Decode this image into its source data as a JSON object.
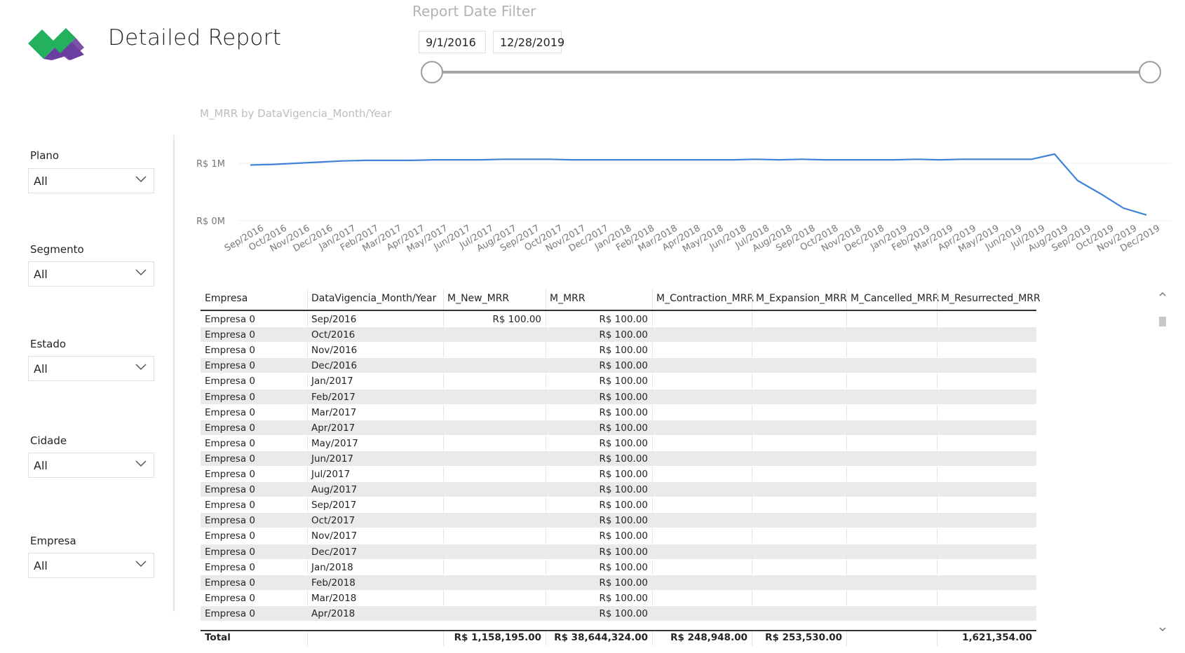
{
  "header": {
    "title": "Detailed Report"
  },
  "date_filter": {
    "title": "Report Date Filter",
    "start": "9/1/2016",
    "end": "12/28/2019"
  },
  "slicers": [
    {
      "label": "Plano",
      "value": "All"
    },
    {
      "label": "Segmento",
      "value": "All"
    },
    {
      "label": "Estado",
      "value": "All"
    },
    {
      "label": "Cidade",
      "value": "All"
    },
    {
      "label": "Empresa",
      "value": "All"
    }
  ],
  "chart_data": {
    "type": "line",
    "title": "M_MRR by DataVigencia_Month/Year",
    "categories": [
      "Sep/2016",
      "Oct/2016",
      "Nov/2016",
      "Dec/2016",
      "Jan/2017",
      "Feb/2017",
      "Mar/2017",
      "Apr/2017",
      "May/2017",
      "Jun/2017",
      "Jul/2017",
      "Aug/2017",
      "Sep/2017",
      "Oct/2017",
      "Nov/2017",
      "Dec/2017",
      "Jan/2018",
      "Feb/2018",
      "Mar/2018",
      "Apr/2018",
      "May/2018",
      "Jun/2018",
      "Jul/2018",
      "Aug/2018",
      "Sep/2018",
      "Oct/2018",
      "Nov/2018",
      "Dec/2018",
      "Jan/2019",
      "Feb/2019",
      "Mar/2019",
      "Apr/2019",
      "May/2019",
      "Jun/2019",
      "Jul/2019",
      "Aug/2019",
      "Sep/2019",
      "Oct/2019",
      "Nov/2019",
      "Dec/2019"
    ],
    "values": [
      0.97,
      0.98,
      1.0,
      1.02,
      1.04,
      1.05,
      1.05,
      1.05,
      1.06,
      1.06,
      1.06,
      1.07,
      1.07,
      1.07,
      1.06,
      1.06,
      1.06,
      1.06,
      1.06,
      1.06,
      1.06,
      1.06,
      1.07,
      1.06,
      1.07,
      1.06,
      1.06,
      1.06,
      1.06,
      1.07,
      1.06,
      1.07,
      1.07,
      1.07,
      1.07,
      1.16,
      0.7,
      0.47,
      0.22,
      0.1
    ],
    "yticks": [
      {
        "value": 0,
        "label": "R$ 0M"
      },
      {
        "value": 1,
        "label": "R$ 1M"
      }
    ],
    "ylim": [
      0,
      1.2
    ],
    "color": "#3f83d6",
    "grid": true
  },
  "table": {
    "columns": [
      "Empresa",
      "DataVigencia_Month/Year",
      "M_New_MRR",
      "M_MRR",
      "M_Contraction_MRR",
      "M_Expansion_MRR",
      "M_Cancelled_MRR",
      "M_Resurrected_MRR"
    ],
    "rows": [
      [
        "Empresa 0",
        "Sep/2016",
        "R$ 100.00",
        "R$ 100.00",
        "",
        "",
        "",
        ""
      ],
      [
        "Empresa 0",
        "Oct/2016",
        "",
        "R$ 100.00",
        "",
        "",
        "",
        ""
      ],
      [
        "Empresa 0",
        "Nov/2016",
        "",
        "R$ 100.00",
        "",
        "",
        "",
        ""
      ],
      [
        "Empresa 0",
        "Dec/2016",
        "",
        "R$ 100.00",
        "",
        "",
        "",
        ""
      ],
      [
        "Empresa 0",
        "Jan/2017",
        "",
        "R$ 100.00",
        "",
        "",
        "",
        ""
      ],
      [
        "Empresa 0",
        "Feb/2017",
        "",
        "R$ 100.00",
        "",
        "",
        "",
        ""
      ],
      [
        "Empresa 0",
        "Mar/2017",
        "",
        "R$ 100.00",
        "",
        "",
        "",
        ""
      ],
      [
        "Empresa 0",
        "Apr/2017",
        "",
        "R$ 100.00",
        "",
        "",
        "",
        ""
      ],
      [
        "Empresa 0",
        "May/2017",
        "",
        "R$ 100.00",
        "",
        "",
        "",
        ""
      ],
      [
        "Empresa 0",
        "Jun/2017",
        "",
        "R$ 100.00",
        "",
        "",
        "",
        ""
      ],
      [
        "Empresa 0",
        "Jul/2017",
        "",
        "R$ 100.00",
        "",
        "",
        "",
        ""
      ],
      [
        "Empresa 0",
        "Aug/2017",
        "",
        "R$ 100.00",
        "",
        "",
        "",
        ""
      ],
      [
        "Empresa 0",
        "Sep/2017",
        "",
        "R$ 100.00",
        "",
        "",
        "",
        ""
      ],
      [
        "Empresa 0",
        "Oct/2017",
        "",
        "R$ 100.00",
        "",
        "",
        "",
        ""
      ],
      [
        "Empresa 0",
        "Nov/2017",
        "",
        "R$ 100.00",
        "",
        "",
        "",
        ""
      ],
      [
        "Empresa 0",
        "Dec/2017",
        "",
        "R$ 100.00",
        "",
        "",
        "",
        ""
      ],
      [
        "Empresa 0",
        "Jan/2018",
        "",
        "R$ 100.00",
        "",
        "",
        "",
        ""
      ],
      [
        "Empresa 0",
        "Feb/2018",
        "",
        "R$ 100.00",
        "",
        "",
        "",
        ""
      ],
      [
        "Empresa 0",
        "Mar/2018",
        "",
        "R$ 100.00",
        "",
        "",
        "",
        ""
      ],
      [
        "Empresa 0",
        "Apr/2018",
        "",
        "R$ 100.00",
        "",
        "",
        "",
        ""
      ]
    ],
    "total": [
      "Total",
      "",
      "R$ 1,158,195.00",
      "R$ 38,644,324.00",
      "R$ 248,948.00",
      "R$ 253,530.00",
      "",
      "1,621,354.00"
    ]
  },
  "colors": {
    "logo_green": "#23b15d",
    "logo_purple": "#6b3fa0",
    "line": "#3f83d6",
    "row_alt": "#eaeaea"
  }
}
